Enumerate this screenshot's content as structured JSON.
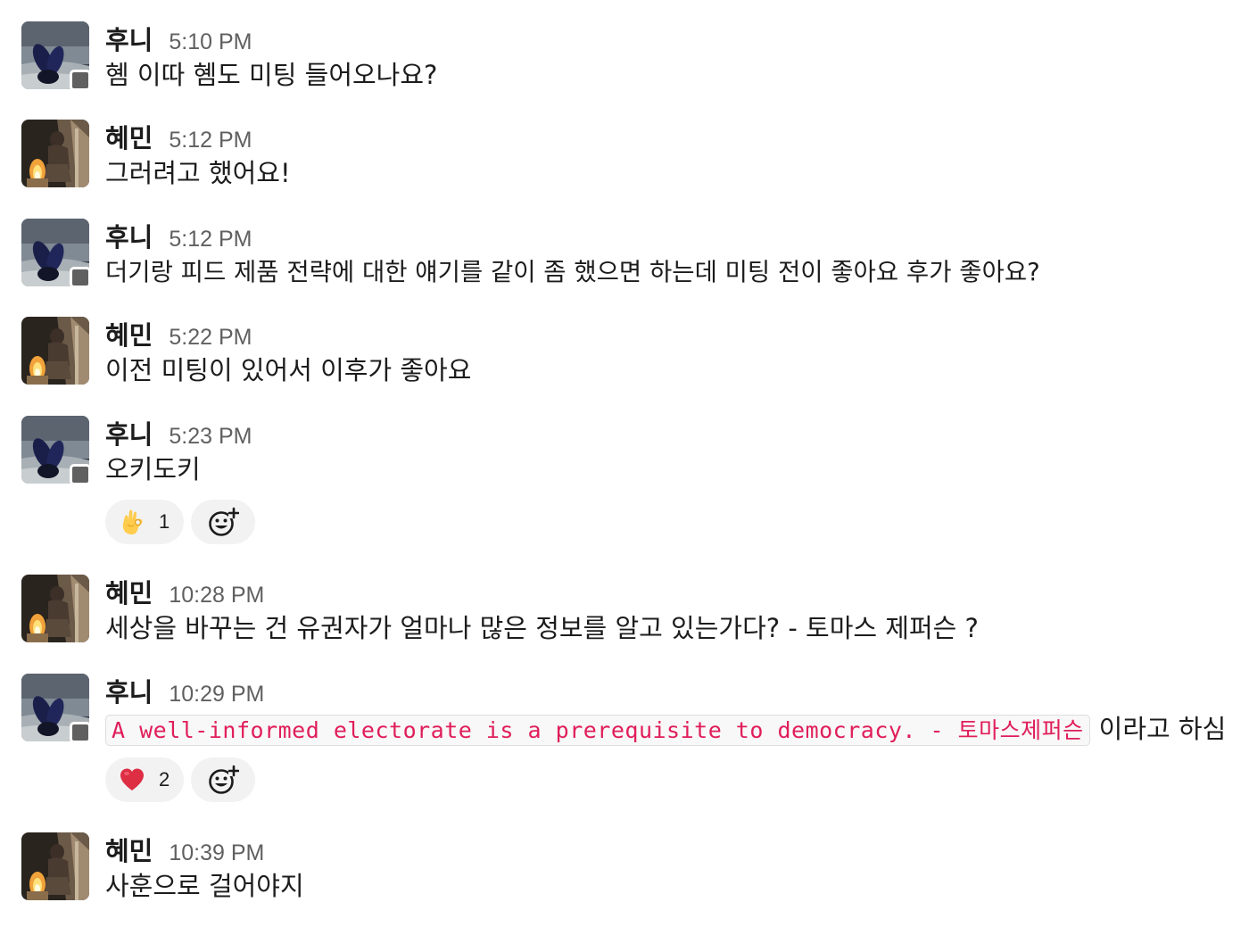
{
  "users": {
    "huni": "후니",
    "hyemin": "혜민"
  },
  "messages": [
    {
      "author": "후니",
      "time": "5:10 PM",
      "text": "혬 이따 혬도 미팅 들어오나요?"
    },
    {
      "author": "혜민",
      "time": "5:12 PM",
      "text": "그러려고 했어요!"
    },
    {
      "author": "후니",
      "time": "5:12 PM",
      "text": "더기랑 피드 제품 전략에 대한 얘기를 같이 좀 했으면 하는데 미팅 전이 좋아요 후가 좋아요?"
    },
    {
      "author": "혜민",
      "time": "5:22 PM",
      "text": "이전 미팅이 있어서 이후가 좋아요"
    },
    {
      "author": "후니",
      "time": "5:23 PM",
      "text": "오키도키",
      "reactions": [
        {
          "emoji": "ok-hand",
          "count": "1"
        }
      ]
    },
    {
      "author": "혜민",
      "time": "10:28 PM",
      "text": "세상을 바꾸는 건 유권자가 얼마나 많은 정보를 알고 있는가다? - 토마스 제퍼슨 ?"
    },
    {
      "author": "후니",
      "time": "10:29 PM",
      "code": "A well-informed electorate is a prerequisite to democracy. - 토마스제퍼슨",
      "text_after_code": "이라고 하심",
      "reactions": [
        {
          "emoji": "red-heart",
          "count": "2"
        }
      ]
    },
    {
      "author": "혜민",
      "time": "10:39 PM",
      "text": "사훈으로 걸어야지"
    }
  ],
  "colors": {
    "text": "#1d1c1d",
    "timestamp": "#616061",
    "code_text": "#e01e5a",
    "code_bg": "#f8f8f8",
    "reaction_bg": "#f2f2f2",
    "presence": "#616061"
  },
  "icons": {
    "add_reaction": "add-reaction-icon",
    "presence": "presence-status-icon"
  }
}
